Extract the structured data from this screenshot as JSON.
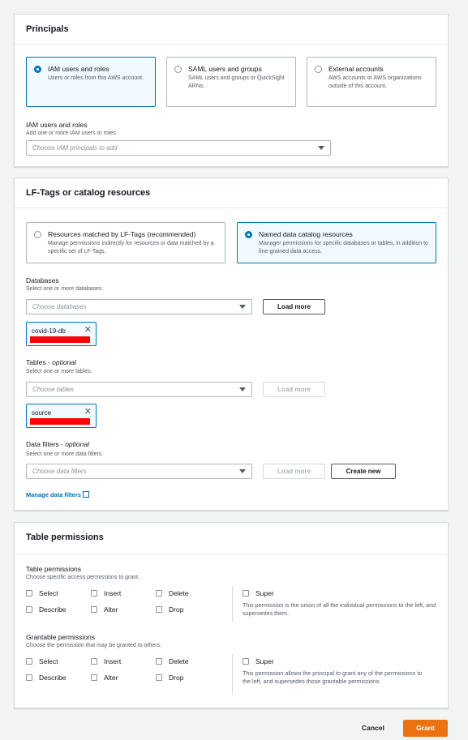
{
  "principals": {
    "title": "Principals",
    "tiles": [
      {
        "title": "IAM users and roles",
        "desc": "Users or roles from this AWS account.",
        "selected": true
      },
      {
        "title": "SAML users and groups",
        "desc": "SAML users and groups or QuickSight ARNs.",
        "selected": false
      },
      {
        "title": "External accounts",
        "desc": "AWS accounts or AWS organizations outside of this account.",
        "selected": false
      }
    ],
    "iam_label": "IAM users and roles",
    "iam_desc": "Add one or more IAM users or roles.",
    "iam_placeholder": "Choose IAM principals to add"
  },
  "resources": {
    "title": "LF-Tags or catalog resources",
    "tiles": [
      {
        "title": "Resources matched by LF-Tags (recommended)",
        "desc": "Manage permissions indirectly for resources or data matched by a specific set of LF-Tags.",
        "selected": false
      },
      {
        "title": "Named data catalog resources",
        "desc": "Manager permissions for specific databases or tables, in addition to fine-grained data access.",
        "selected": true
      }
    ],
    "databases": {
      "label": "Databases",
      "desc": "Select one or more databases.",
      "placeholder": "Choose databases",
      "load_more": "Load more",
      "token": "covid-19-db"
    },
    "tables": {
      "label": "Tables - ",
      "optional": "optional",
      "desc": "Select one or more tables.",
      "placeholder": "Choose tables",
      "load_more": "Load more",
      "token": "source"
    },
    "filters": {
      "label": "Data filters - ",
      "optional": "optional",
      "desc": "Select one or more data filters.",
      "placeholder": "Choose data filters",
      "load_more": "Load more",
      "create_new": "Create new",
      "manage_link": "Manage data filters"
    }
  },
  "permissions": {
    "title": "Table permissions",
    "table": {
      "label": "Table permissions",
      "desc": "Choose specific access permissions to grant.",
      "row1": [
        "Select",
        "Insert",
        "Delete"
      ],
      "row2": [
        "Describe",
        "Alter",
        "Drop"
      ],
      "super": "Super",
      "note": "This permission is the union of all the individual permissions to the left, and supersedes them."
    },
    "grantable": {
      "label": "Grantable permissions",
      "desc": "Choose the permission that may be granted to others.",
      "row1": [
        "Select",
        "Insert",
        "Delete"
      ],
      "row2": [
        "Describe",
        "Alter",
        "Drop"
      ],
      "super": "Super",
      "note": "This permission allows the principal to grant any of the permissions to the left, and supersedes those grantable permissions."
    }
  },
  "footer": {
    "cancel": "Cancel",
    "grant": "Grant"
  },
  "colors": {
    "accent": "#0073bb",
    "primary_button": "#ec7211",
    "redaction": "#ff0000"
  }
}
